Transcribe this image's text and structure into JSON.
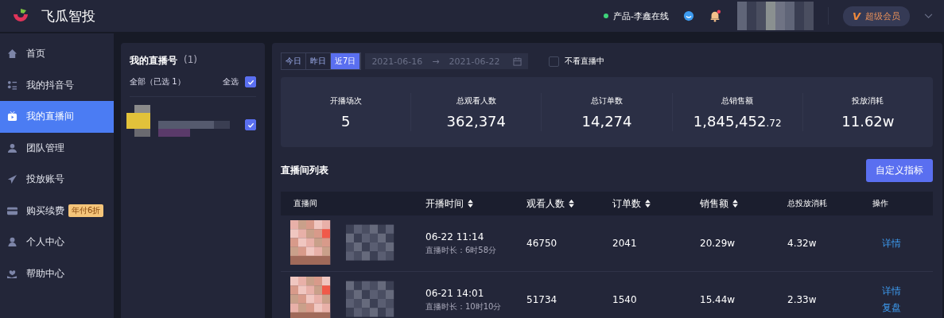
{
  "header": {
    "brand": "飞瓜智投",
    "status": {
      "text": "产品-李鑫在线",
      "online": true
    },
    "notifications_unread": true,
    "vip": {
      "mark": "V",
      "label": "超级会员"
    }
  },
  "sidebar": {
    "items": [
      {
        "label": "首页",
        "selected": false
      },
      {
        "label": "我的抖音号",
        "selected": false
      },
      {
        "label": "我的直播间",
        "selected": true
      },
      {
        "label": "团队管理",
        "selected": false
      },
      {
        "label": "投放账号",
        "selected": false
      },
      {
        "label": "购买续费",
        "selected": false,
        "badge": "年付6折"
      },
      {
        "label": "个人中心",
        "selected": false
      },
      {
        "label": "帮助中心",
        "selected": false
      }
    ]
  },
  "accounts": {
    "title": "我的直播号",
    "count": "(1)",
    "filter": "全部（已选 1）",
    "select_all": {
      "label": "全选",
      "checked": true
    },
    "items": [
      {
        "kind": "picture",
        "checked": true
      }
    ]
  },
  "date_range": {
    "tabs": [
      {
        "label": "今日",
        "selected": false
      },
      {
        "label": "昨日",
        "selected": false
      },
      {
        "label": "近7日",
        "selected": true
      }
    ],
    "start": "2021-06-16",
    "separator": "→",
    "end": "2021-06-22"
  },
  "hide_live": {
    "label": "不看直播中",
    "checked": false
  },
  "stats": [
    {
      "label": "开播场次",
      "value": "5"
    },
    {
      "label": "总观看人数",
      "value": "362,374"
    },
    {
      "label": "总订单数",
      "value": "14,274"
    },
    {
      "label": "总销售额",
      "value": "1,845,452",
      "fraction": ".72"
    },
    {
      "label": "投放消耗",
      "value": "11.62w"
    }
  ],
  "list": {
    "title": "直播间列表",
    "button": "自定义指标",
    "columns": [
      {
        "label": "直播间",
        "sortable": false
      },
      {
        "label": "开播时间",
        "sortable": true
      },
      {
        "label": "观看人数",
        "sortable": true
      },
      {
        "label": "订单数",
        "sortable": true
      },
      {
        "label": "销售额",
        "sortable": true
      },
      {
        "label": "总投放消耗",
        "sortable": false
      },
      {
        "label": "操作",
        "sortable": false
      }
    ],
    "rows": [
      {
        "time": "06-22 11:14",
        "duration": "直播时长：6时58分",
        "viewers": "46750",
        "orders": "2041",
        "sales": "20.29w",
        "spend": "4.32w",
        "actions": [
          "详情"
        ]
      },
      {
        "time": "06-21 14:01",
        "duration": "直播时长：10时10分",
        "viewers": "51734",
        "orders": "1540",
        "sales": "15.44w",
        "spend": "2.33w",
        "actions": [
          "详情",
          "复盘"
        ]
      }
    ]
  }
}
